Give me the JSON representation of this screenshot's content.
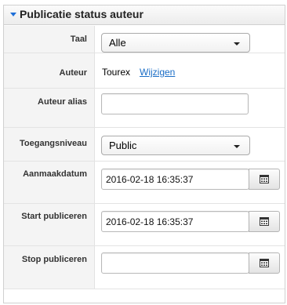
{
  "panel": {
    "title": "Publicatie status auteur"
  },
  "fields": {
    "taal": {
      "label": "Taal",
      "value": "Alle"
    },
    "auteur": {
      "label": "Auteur",
      "value": "Tourex",
      "change_link": "Wijzigen"
    },
    "auteur_alias": {
      "label": "Auteur alias",
      "value": ""
    },
    "toegangsniveau": {
      "label": "Toegangsniveau",
      "value": "Public"
    },
    "aanmaakdatum": {
      "label": "Aanmaakdatum",
      "value": "2016-02-18 16:35:37"
    },
    "start_publiceren": {
      "label": "Start publiceren",
      "value": "2016-02-18 16:35:37"
    },
    "stop_publiceren": {
      "label": "Stop publiceren",
      "value": ""
    }
  },
  "icons": {
    "section_toggle": "caret-down-icon",
    "calendar": "calendar-icon"
  },
  "colors": {
    "accent": "#1f6fd8",
    "link": "#1a6dc6"
  }
}
